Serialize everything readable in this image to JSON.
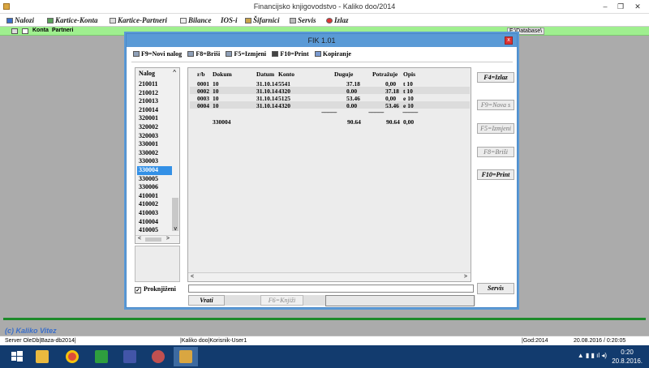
{
  "window": {
    "title": "Financijsko knjigovodstvo - Kaliko doo/2014",
    "minimize": "–",
    "restore": "❐",
    "close": "✕"
  },
  "menu": {
    "nalozi": "Nalozi",
    "kartice_konta": "Kartice-Konta",
    "kartice_partneri": "Kartice-Partneri",
    "bilance": "Bilance",
    "ios": "IOS-i",
    "sifarnici": "Šifarnici",
    "servis": "Servis",
    "izlaz": "Izlaz"
  },
  "greenbar": {
    "konta": "Konta",
    "partneri": "Partneri",
    "db_path": "F:\\Database\\"
  },
  "dialog": {
    "title": "FIK 1.01",
    "close": "x",
    "toolbar": {
      "novi_nalog": "F9=Novi nalog",
      "brisi": "F8=Briši",
      "izmjeni": "F5=Izmjeni",
      "print": "F10=Print",
      "kopiranje": "Kopiranje"
    },
    "nalog_header": "Nalog",
    "up_arrow": "^",
    "down_arrow": "v",
    "left_arrow": "<",
    "right_arrow": ">",
    "nalozi": [
      "210011",
      "210012",
      "210013",
      "210014",
      "320001",
      "320002",
      "320003",
      "330001",
      "330002",
      "330003",
      "330004",
      "330005",
      "330006",
      "410001",
      "410002",
      "410003",
      "410004",
      "410005"
    ],
    "selected_nalog": "330004",
    "columns": {
      "rb": "r/b",
      "dokum": "Dokum",
      "datum": "Datum",
      "konto": "Konto",
      "duguje": "Duguje",
      "potrazuje": "Potražuje",
      "opis": "Opis"
    },
    "rows": [
      {
        "rb": "0001",
        "dokum": "10",
        "datum": "31.10.14",
        "konto": "5541",
        "duguje": "37.18",
        "potrazuje": "0,00",
        "opis": "t 10"
      },
      {
        "rb": "0002",
        "dokum": "10",
        "datum": "31.10.14",
        "konto": "4320",
        "duguje": "0.00",
        "potrazuje": "37.18",
        "opis": "t 10"
      },
      {
        "rb": "0003",
        "dokum": "10",
        "datum": "31.10.14",
        "konto": "5125",
        "duguje": "53.46",
        "potrazuje": "0,00",
        "opis": "e 10"
      },
      {
        "rb": "0004",
        "dokum": "10",
        "datum": "31.10.14",
        "konto": "4320",
        "duguje": "0.00",
        "potrazuje": "53.46",
        "opis": "e 10"
      }
    ],
    "separator": "--------------",
    "total": {
      "nalog": "330004",
      "duguje": "90.64",
      "potrazuje": "90.64",
      "saldo": "0,00"
    },
    "buttons": {
      "izlaz": "F4=Izlaz",
      "nova_s": "F9=Nova s",
      "izmjeni": "F5=Izmjeni",
      "brisi": "F8=Briši",
      "print": "F10=Print",
      "servis": "Servis",
      "vrati": "Vrati",
      "knjizi": "F6=Knjiži"
    },
    "proknjizeni": "Proknjiženi",
    "check_mark": "✓"
  },
  "brand": "(c) Kaliko Vitez",
  "status": {
    "server": "Server OleDb|Baza-db2014|",
    "firma": "|Kaliko doo|Korisnik-User1",
    "god": "|God:2014",
    "datetime": "20.08.2016 / 0:20:05"
  },
  "taskbar": {
    "tray": "▲ ▮ ▮ ıl ◂)",
    "time": "0:20",
    "date": "20.8.2016."
  }
}
